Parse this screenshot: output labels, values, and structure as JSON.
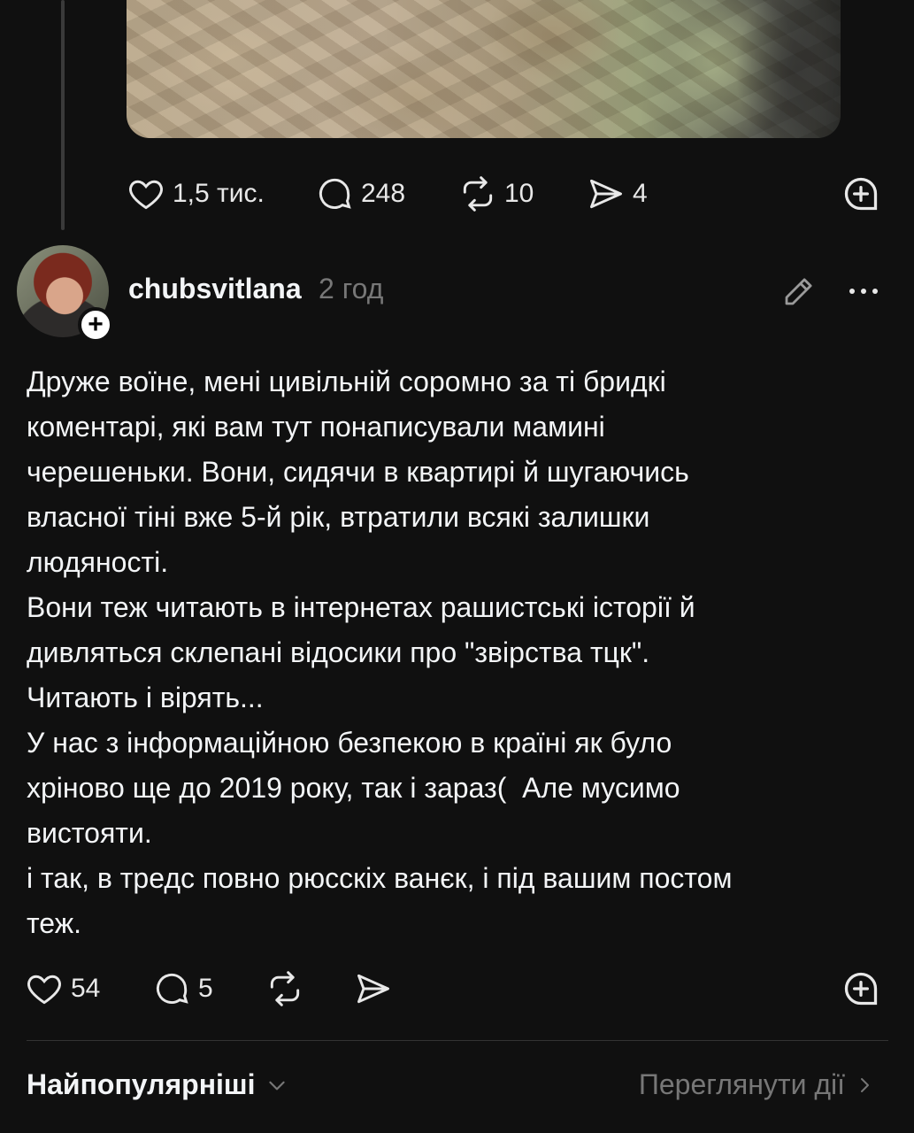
{
  "top_post": {
    "likes": "1,5 тис.",
    "comments": "248",
    "reposts": "10",
    "shares": "4"
  },
  "reply": {
    "username": "chubsvitlana",
    "time": "2 год",
    "text": "Друже воїне, мені цивільній соромно за ті бридкі\nкоментарі, які вам тут понаписували мамині\nчерешеньки. Вони, сидячи в квартирі й шугаючись\nвласної тіні вже 5-й рік, втратили всякі залишки\nлюдяності.\nВони теж читають в інтернетах рашистські історії й\nдивляться склепані відосики про \"звірства тцк\".\nЧитають і вірять...\nУ нас з інформаційною безпекою в країні як було\nхріново ще до 2019 року, так і зараз(  Але мусимо\nвистояти.\nі так, в тредс повно рюсскіх ванєк, і під вашим постом\nтеж.",
    "likes": "54",
    "comments": "5"
  },
  "footer": {
    "sort_label": "Найпопулярніші",
    "view_activity": "Переглянути дії"
  },
  "icons": {
    "like": "heart-icon",
    "comment": "comment-bubble-icon",
    "repost": "repost-icon",
    "share": "send-icon",
    "save": "add-circle-icon",
    "edit": "pencil-icon",
    "more": "more-dots-icon"
  }
}
